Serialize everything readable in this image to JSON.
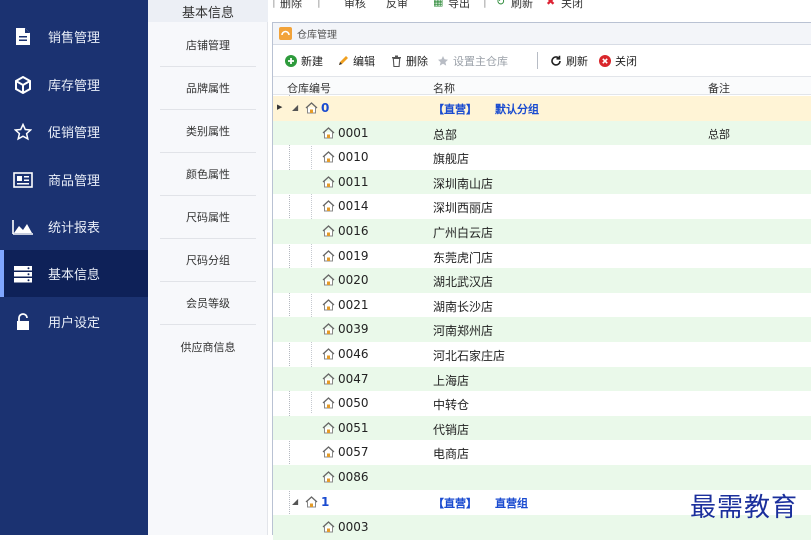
{
  "nav": {
    "items": [
      {
        "label": "销售管理",
        "icon": "document-icon"
      },
      {
        "label": "库存管理",
        "icon": "cube-icon"
      },
      {
        "label": "促销管理",
        "icon": "star-icon"
      },
      {
        "label": "商品管理",
        "icon": "card-icon"
      },
      {
        "label": "统计报表",
        "icon": "chart-icon"
      },
      {
        "label": "基本信息",
        "icon": "server-icon",
        "active": true
      },
      {
        "label": "用户设定",
        "icon": "lock-icon"
      }
    ]
  },
  "subnav": {
    "header": "基本信息",
    "items": [
      "店铺管理",
      "品牌属性",
      "类别属性",
      "颜色属性",
      "尺码属性",
      "尺码分组",
      "会员等级",
      "供应商信息"
    ]
  },
  "top_toolbar": {
    "items": [
      "删除",
      "审核",
      "反审",
      "导出",
      "刷新",
      "关闭"
    ]
  },
  "window": {
    "title": "仓库管理",
    "toolbar": {
      "new": "新建",
      "edit": "编辑",
      "delete": "删除",
      "set_main": "设置主仓库",
      "refresh": "刷新",
      "close": "关闭"
    },
    "columns": {
      "code": "仓库编号",
      "name": "名称",
      "remark": "备注"
    },
    "groups": [
      {
        "code": "0",
        "tag": "【直营】",
        "name": "默认分组"
      },
      {
        "code": "1",
        "tag": "【直营】",
        "name": "直营组"
      }
    ],
    "rows": [
      {
        "code": "0001",
        "name": "总部",
        "remark": "总部"
      },
      {
        "code": "0010",
        "name": "旗舰店",
        "remark": ""
      },
      {
        "code": "0011",
        "name": "深圳南山店",
        "remark": ""
      },
      {
        "code": "0014",
        "name": "深圳西丽店",
        "remark": ""
      },
      {
        "code": "0016",
        "name": "广州白云店",
        "remark": ""
      },
      {
        "code": "0019",
        "name": "东莞虎门店",
        "remark": ""
      },
      {
        "code": "0020",
        "name": "湖北武汉店",
        "remark": ""
      },
      {
        "code": "0021",
        "name": "湖南长沙店",
        "remark": ""
      },
      {
        "code": "0039",
        "name": "河南郑州店",
        "remark": ""
      },
      {
        "code": "0046",
        "name": "河北石家庄店",
        "remark": ""
      },
      {
        "code": "0047",
        "name": "上海店",
        "remark": ""
      },
      {
        "code": "0050",
        "name": "中转仓",
        "remark": ""
      },
      {
        "code": "0051",
        "name": "代销店",
        "remark": ""
      },
      {
        "code": "0057",
        "name": "电商店",
        "remark": ""
      },
      {
        "code": "0086",
        "name": "",
        "remark": ""
      }
    ],
    "last_row": {
      "code": "0003"
    }
  },
  "watermark": "最需教育",
  "colors": {
    "nav_bg": "#1b3271",
    "nav_active": "#0e2158",
    "row_alt": "#eaf9ea",
    "group_row": "#fff4d6",
    "link_blue": "#1a4bd0"
  }
}
